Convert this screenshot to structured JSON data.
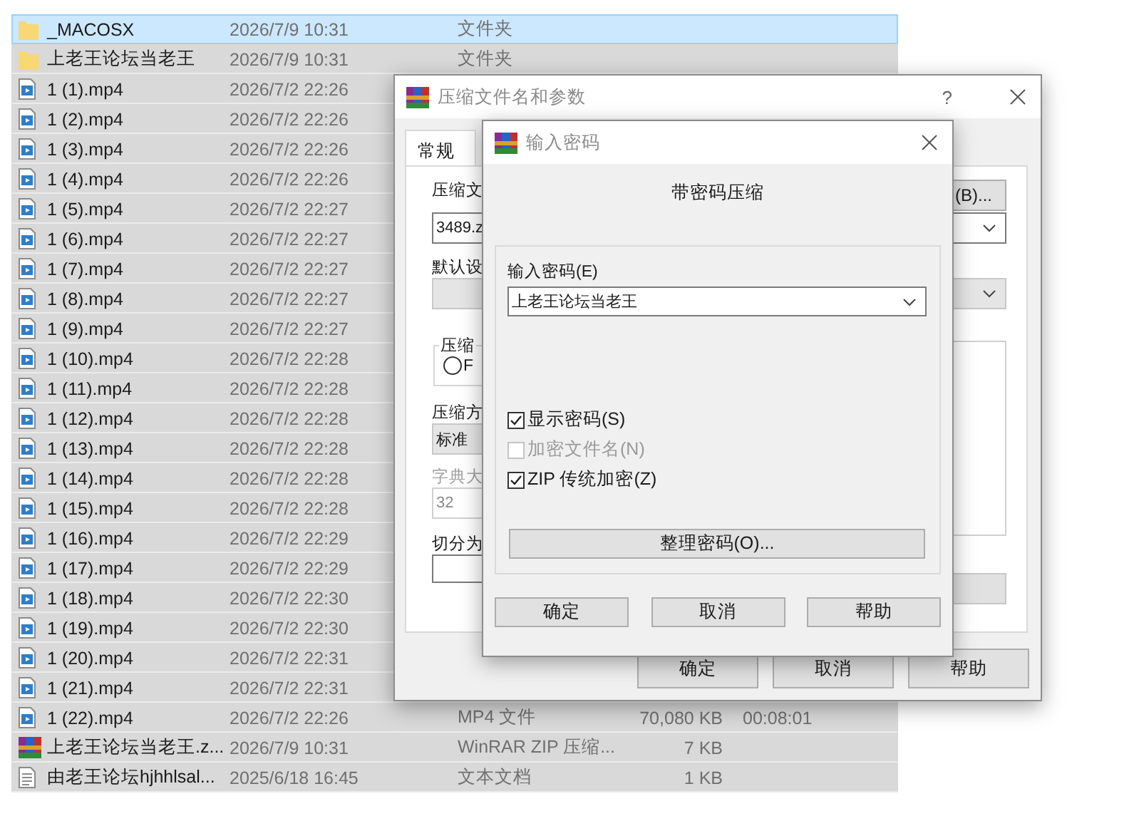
{
  "file_list": {
    "rows": [
      {
        "kind": "folder",
        "name": "_MACOSX",
        "date": "2026/7/9 10:31",
        "type": "文件夹",
        "selected": true
      },
      {
        "kind": "folder",
        "name": "上老王论坛当老王",
        "date": "2026/7/9 10:31",
        "type": "文件夹",
        "selected": false
      },
      {
        "kind": "video",
        "name": "1 (1).mp4",
        "date": "2026/7/2 22:26",
        "selected": false
      },
      {
        "kind": "video",
        "name": "1 (2).mp4",
        "date": "2026/7/2 22:26",
        "selected": false
      },
      {
        "kind": "video",
        "name": "1 (3).mp4",
        "date": "2026/7/2 22:26",
        "selected": false
      },
      {
        "kind": "video",
        "name": "1 (4).mp4",
        "date": "2026/7/2 22:26",
        "selected": false
      },
      {
        "kind": "video",
        "name": "1 (5).mp4",
        "date": "2026/7/2 22:27",
        "selected": false
      },
      {
        "kind": "video",
        "name": "1 (6).mp4",
        "date": "2026/7/2 22:27",
        "selected": false
      },
      {
        "kind": "video",
        "name": "1 (7).mp4",
        "date": "2026/7/2 22:27",
        "selected": false
      },
      {
        "kind": "video",
        "name": "1 (8).mp4",
        "date": "2026/7/2 22:27",
        "selected": false
      },
      {
        "kind": "video",
        "name": "1 (9).mp4",
        "date": "2026/7/2 22:27",
        "selected": false
      },
      {
        "kind": "video",
        "name": "1 (10).mp4",
        "date": "2026/7/2 22:28",
        "selected": false
      },
      {
        "kind": "video",
        "name": "1 (11).mp4",
        "date": "2026/7/2 22:28",
        "selected": false
      },
      {
        "kind": "video",
        "name": "1 (12).mp4",
        "date": "2026/7/2 22:28",
        "selected": false
      },
      {
        "kind": "video",
        "name": "1 (13).mp4",
        "date": "2026/7/2 22:28",
        "selected": false
      },
      {
        "kind": "video",
        "name": "1 (14).mp4",
        "date": "2026/7/2 22:28",
        "selected": false
      },
      {
        "kind": "video",
        "name": "1 (15).mp4",
        "date": "2026/7/2 22:28",
        "selected": false
      },
      {
        "kind": "video",
        "name": "1 (16).mp4",
        "date": "2026/7/2 22:29",
        "selected": false
      },
      {
        "kind": "video",
        "name": "1 (17).mp4",
        "date": "2026/7/2 22:29",
        "selected": false
      },
      {
        "kind": "video",
        "name": "1 (18).mp4",
        "date": "2026/7/2 22:30",
        "selected": false
      },
      {
        "kind": "video",
        "name": "1 (19).mp4",
        "date": "2026/7/2 22:30",
        "selected": false
      },
      {
        "kind": "video",
        "name": "1 (20).mp4",
        "date": "2026/7/2 22:31",
        "selected": false
      },
      {
        "kind": "video",
        "name": "1 (21).mp4",
        "date": "2026/7/2 22:31",
        "selected": false
      },
      {
        "kind": "video",
        "name": "1 (22).mp4",
        "date": "2026/7/2 22:26",
        "type": "MP4 文件",
        "size": "70,080 KB",
        "duration": "00:08:01",
        "selected": false
      },
      {
        "kind": "archive",
        "name": "上老王论坛当老王.z...",
        "date": "2026/7/9 10:31",
        "type": "WinRAR ZIP 压缩...",
        "size": "7 KB",
        "selected": false
      },
      {
        "kind": "text",
        "name": "由老王论坛hjhhlsal...",
        "date": "2025/6/18 16:45",
        "type": "文本文档",
        "size": "1 KB",
        "selected": false
      }
    ]
  },
  "archive_dialog": {
    "title": "压缩文件名和参数",
    "help": "?",
    "tabs": [
      {
        "label": "常规",
        "selected": true
      }
    ],
    "archive_name_label": "压缩文",
    "archive_name": "3489.z",
    "browse_button": "(B)...",
    "profile_label": "默认设",
    "format_group_label": "压缩",
    "format_option": {
      "label": "F",
      "selected": false
    },
    "method_label": "压缩方",
    "method_value": "标准",
    "dictionary": {
      "label": "字典大",
      "value": "32",
      "disabled": true
    },
    "split_label": "切分为",
    "buttons": [
      "确定",
      "取消",
      "帮助"
    ]
  },
  "password_dialog": {
    "title": "输入密码",
    "heading": "带密码压缩",
    "password_label": "输入密码(E)",
    "password_value": "上老王论坛当老王",
    "options": [
      {
        "label": "显示密码(S)",
        "checked": true,
        "disabled": false
      },
      {
        "label": "加密文件名(N)",
        "checked": false,
        "disabled": true
      },
      {
        "label": "ZIP 传统加密(Z)",
        "checked": true,
        "disabled": false
      }
    ],
    "organize_button": "整理密码(O)...",
    "buttons": [
      "确定",
      "取消",
      "帮助"
    ]
  }
}
